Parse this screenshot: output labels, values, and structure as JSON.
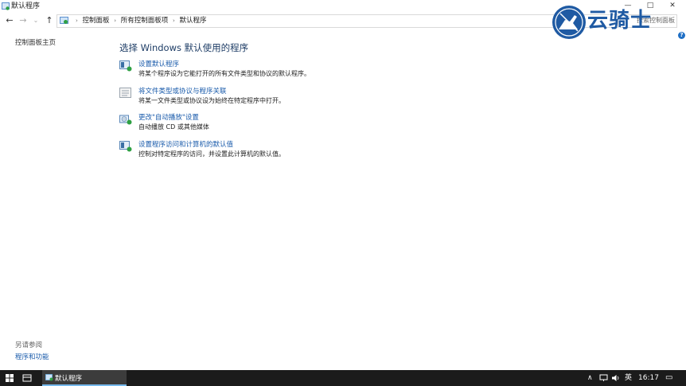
{
  "window": {
    "title": "默认程序",
    "minimize_glyph": "—",
    "maximize_glyph": "□",
    "close_glyph": "✕"
  },
  "address": {
    "back_glyph": "←",
    "forward_glyph": "→",
    "dropdown_glyph": "⌄",
    "up_glyph": "↑",
    "breadcrumbs": [
      "控制面板",
      "所有控制面板项",
      "默认程序"
    ],
    "separator": "›",
    "search_partial": "搜索控制面板"
  },
  "help_glyph": "?",
  "sidebar": {
    "home_link": "控制面板主页",
    "see_also_label": "另请参阅",
    "see_also_link": "程序和功能"
  },
  "main": {
    "title": "选择 Windows 默认使用的程序",
    "tasks": [
      {
        "link": "设置默认程序",
        "desc": "将某个程序设为它能打开的所有文件类型和协议的默认程序。"
      },
      {
        "link": "将文件类型或协议与程序关联",
        "desc": "将某一文件类型或协议设为始终在特定程序中打开。"
      },
      {
        "link": "更改\"自动播放\"设置",
        "desc": "自动播放 CD 或其他媒体"
      },
      {
        "link": "设置程序访问和计算机的默认值",
        "desc": "控制对特定程序的访问，并设置此计算机的默认值。"
      }
    ]
  },
  "watermark": {
    "text": "云骑士"
  },
  "taskbar": {
    "app_label": "默认程序",
    "tray_chevron": "∧",
    "ime": "英",
    "time": "16:17",
    "notification_glyph": "▭"
  },
  "colors": {
    "link_blue": "#1a5bab",
    "title_navy": "#1e3d66",
    "taskbar_bg": "#1b1b1b",
    "watermark_blue": "#1f5aa3"
  }
}
